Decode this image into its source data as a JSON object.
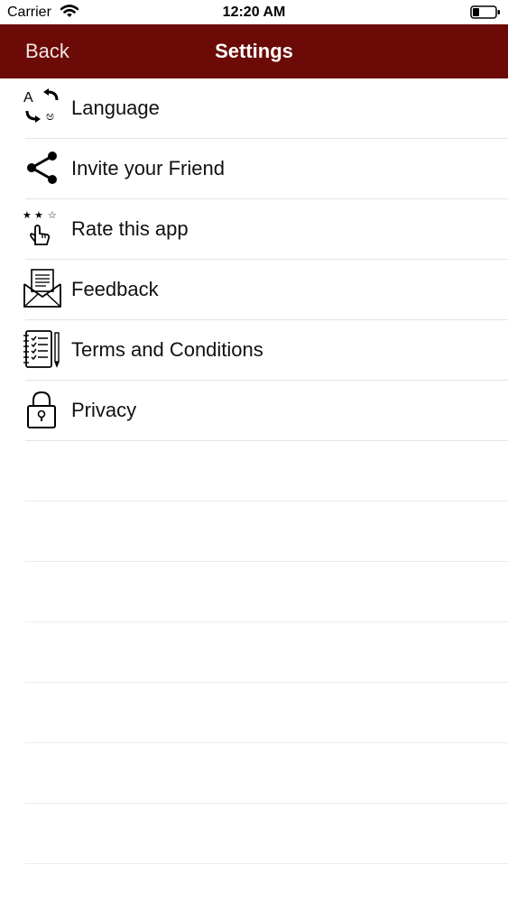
{
  "status_bar": {
    "carrier": "Carrier",
    "time": "12:20 AM"
  },
  "nav": {
    "back_label": "Back",
    "title": "Settings",
    "bar_color": "#6b0a06"
  },
  "menu": {
    "items": [
      {
        "label": "Language",
        "icon": "language-translate-icon"
      },
      {
        "label": "Invite your Friend",
        "icon": "share-icon"
      },
      {
        "label": "Rate this app",
        "icon": "rate-stars-icon"
      },
      {
        "label": "Feedback",
        "icon": "envelope-icon"
      },
      {
        "label": "Terms and Conditions",
        "icon": "notepad-icon"
      },
      {
        "label": "Privacy",
        "icon": "lock-icon"
      }
    ]
  }
}
